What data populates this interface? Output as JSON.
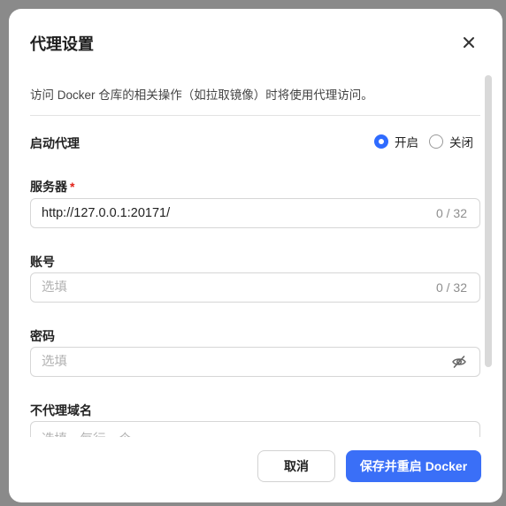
{
  "dialog": {
    "title": "代理设置",
    "description": "访问 Docker 仓库的相关操作（如拉取镜像）时将使用代理访问。"
  },
  "proxy_toggle": {
    "label": "启动代理",
    "options": [
      {
        "label": "开启",
        "selected": true
      },
      {
        "label": "关闭",
        "selected": false
      }
    ]
  },
  "server": {
    "label": "服务器",
    "required_mark": "*",
    "value": "http://127.0.0.1:20171/",
    "counter": "0 / 32"
  },
  "account": {
    "label": "账号",
    "placeholder": "选填",
    "counter": "0 / 32"
  },
  "password": {
    "label": "密码",
    "placeholder": "选填"
  },
  "no_proxy": {
    "label": "不代理域名",
    "placeholder": "选填，每行一个"
  },
  "buttons": {
    "cancel": "取消",
    "save": "保存并重启 Docker"
  },
  "icons": {
    "close": "close-icon",
    "password_visibility": "eye-off-icon"
  },
  "colors": {
    "primary": "#3a6ff7",
    "required": "#e2231a",
    "overlay": "#8a8a8a"
  }
}
